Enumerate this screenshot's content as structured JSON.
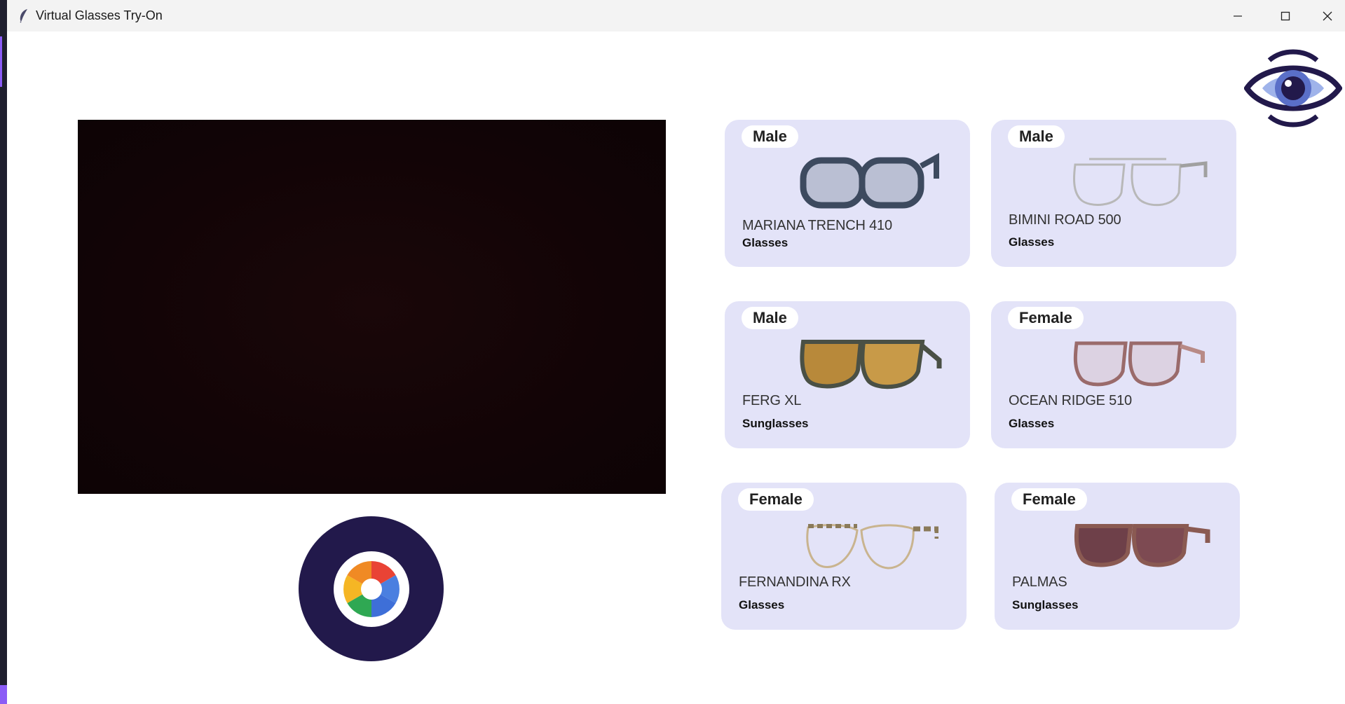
{
  "window": {
    "title": "Virtual Glasses Try-On",
    "controls": [
      "minimize-icon",
      "maximize-icon",
      "close-icon"
    ]
  },
  "logo": {
    "icon": "eye-icon",
    "colors": {
      "dark": "#22194b",
      "mid": "#5a6fc8",
      "light": "#9fb3ea"
    }
  },
  "camera": {
    "state": "live-feed-dark"
  },
  "capture_button": {
    "icon": "camera-shutter-icon",
    "colors": {
      "bg": "#22194b"
    }
  },
  "products": [
    {
      "gender": "Male",
      "name": "MARIANA TRENCH 410",
      "type": "Glasses",
      "frame_color": "#3d4a5f",
      "lens_color": "none"
    },
    {
      "gender": "Male",
      "name": "BIMINI ROAD 500",
      "type": "Glasses",
      "frame_color": "#b8b8b8",
      "lens_color": "none"
    },
    {
      "gender": "Male",
      "name": "FERG XL",
      "type": "Sunglasses",
      "frame_color": "#4a5045",
      "lens_color": "#b8893a"
    },
    {
      "gender": "Female",
      "name": "OCEAN RIDGE 510",
      "type": "Glasses",
      "frame_color": "#9a6b6b",
      "lens_color": "none"
    },
    {
      "gender": "Female",
      "name": "FERNANDINA RX",
      "type": "Glasses",
      "frame_color": "#c9b48f",
      "lens_color": "none"
    },
    {
      "gender": "Female",
      "name": "PALMAS",
      "type": "Sunglasses",
      "frame_color": "#8a5a52",
      "lens_color": "#6e4049"
    }
  ],
  "theme": {
    "card_bg": "#e3e3f8",
    "accent": "#22194b"
  }
}
